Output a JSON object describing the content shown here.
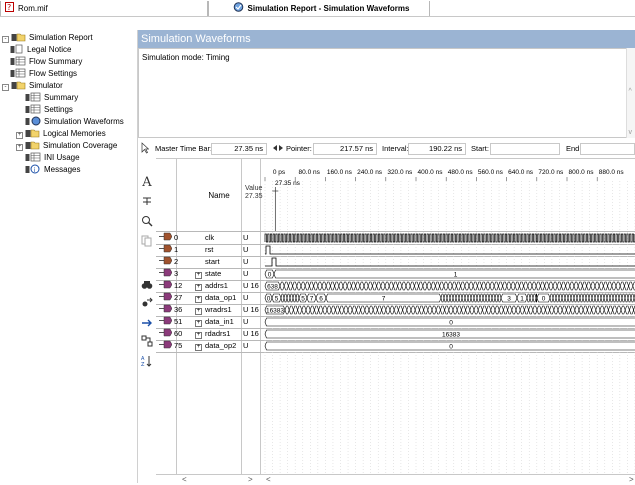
{
  "tabs": [
    {
      "label": "Rom.mif"
    },
    {
      "label": "Simulation Report - Simulation Waveforms"
    }
  ],
  "tree": [
    {
      "label": "Simulation Report",
      "level": 0,
      "expander": "-"
    },
    {
      "label": "Legal Notice",
      "level": 1
    },
    {
      "label": "Flow Summary",
      "level": 1
    },
    {
      "label": "Flow Settings",
      "level": 1
    },
    {
      "label": "Simulator",
      "level": 0,
      "expander": "-"
    },
    {
      "label": "Summary",
      "level": 2
    },
    {
      "label": "Settings",
      "level": 2
    },
    {
      "label": "Simulation Waveforms",
      "level": 2
    },
    {
      "label": "Logical Memories",
      "level": 2,
      "expander": "+"
    },
    {
      "label": "Simulation Coverage",
      "level": 2,
      "expander": "+"
    },
    {
      "label": "INI Usage",
      "level": 2
    },
    {
      "label": "Messages",
      "level": 2
    }
  ],
  "panel": {
    "title": "Simulation Waveforms",
    "mode_text": "Simulation mode: Timing"
  },
  "toolbar": {
    "master_label": "Master Time Bar:",
    "master_value": "27.35 ns",
    "pointer_label": "Pointer:",
    "pointer_value": "217.57 ns",
    "interval_label": "Interval:",
    "interval_value": "190.22 ns",
    "start_label": "Start:",
    "start_value": "",
    "end_label": "End:",
    "end_value": ""
  },
  "grid": {
    "name_header": "Name",
    "value_header": "Value",
    "value_header_sub": "27.35",
    "time_ticks": [
      "0 ps",
      "80.0 ns",
      "160.0 ns",
      "240.0 ns",
      "320.0 ns",
      "400.0 ns",
      "480.0 ns",
      "560.0 ns",
      "640.0 ns",
      "720.0 ns",
      "800.0 ns",
      "880.0 ns"
    ],
    "marker_label": "27.35 ns",
    "signals": [
      {
        "id": "0",
        "name": "clk",
        "value": "U",
        "bus": false
      },
      {
        "id": "1",
        "name": "rst",
        "value": "U",
        "bus": false
      },
      {
        "id": "2",
        "name": "start",
        "value": "U",
        "bus": false
      },
      {
        "id": "3",
        "name": "state",
        "value": "U",
        "bus": true
      },
      {
        "id": "12",
        "name": "addrs1",
        "value": "U 16",
        "bus": true
      },
      {
        "id": "27",
        "name": "data_op1",
        "value": "U",
        "bus": true
      },
      {
        "id": "36",
        "name": "wradrs1",
        "value": "U 16",
        "bus": true
      },
      {
        "id": "51",
        "name": "data_in1",
        "value": "U",
        "bus": true
      },
      {
        "id": "60",
        "name": "rdadrs1",
        "value": "U 16",
        "bus": true
      },
      {
        "id": "75",
        "name": "data_op2",
        "value": "U",
        "bus": true
      }
    ],
    "wave_labels": {
      "state_first": "0",
      "state_main": "1",
      "addrs1_first": "638",
      "data_op1_seq": [
        "0",
        "5",
        "5",
        "7",
        "6",
        "7",
        "3",
        "1",
        "0"
      ],
      "wradrs1_first": "16383",
      "data_in1_main": "0",
      "rdadrs1_main": "16383",
      "data_op2_main": "0"
    }
  },
  "colors": {
    "title_bg": "#9bb4d3",
    "wave": "#000000",
    "grid_line": "#c8c8c8"
  }
}
